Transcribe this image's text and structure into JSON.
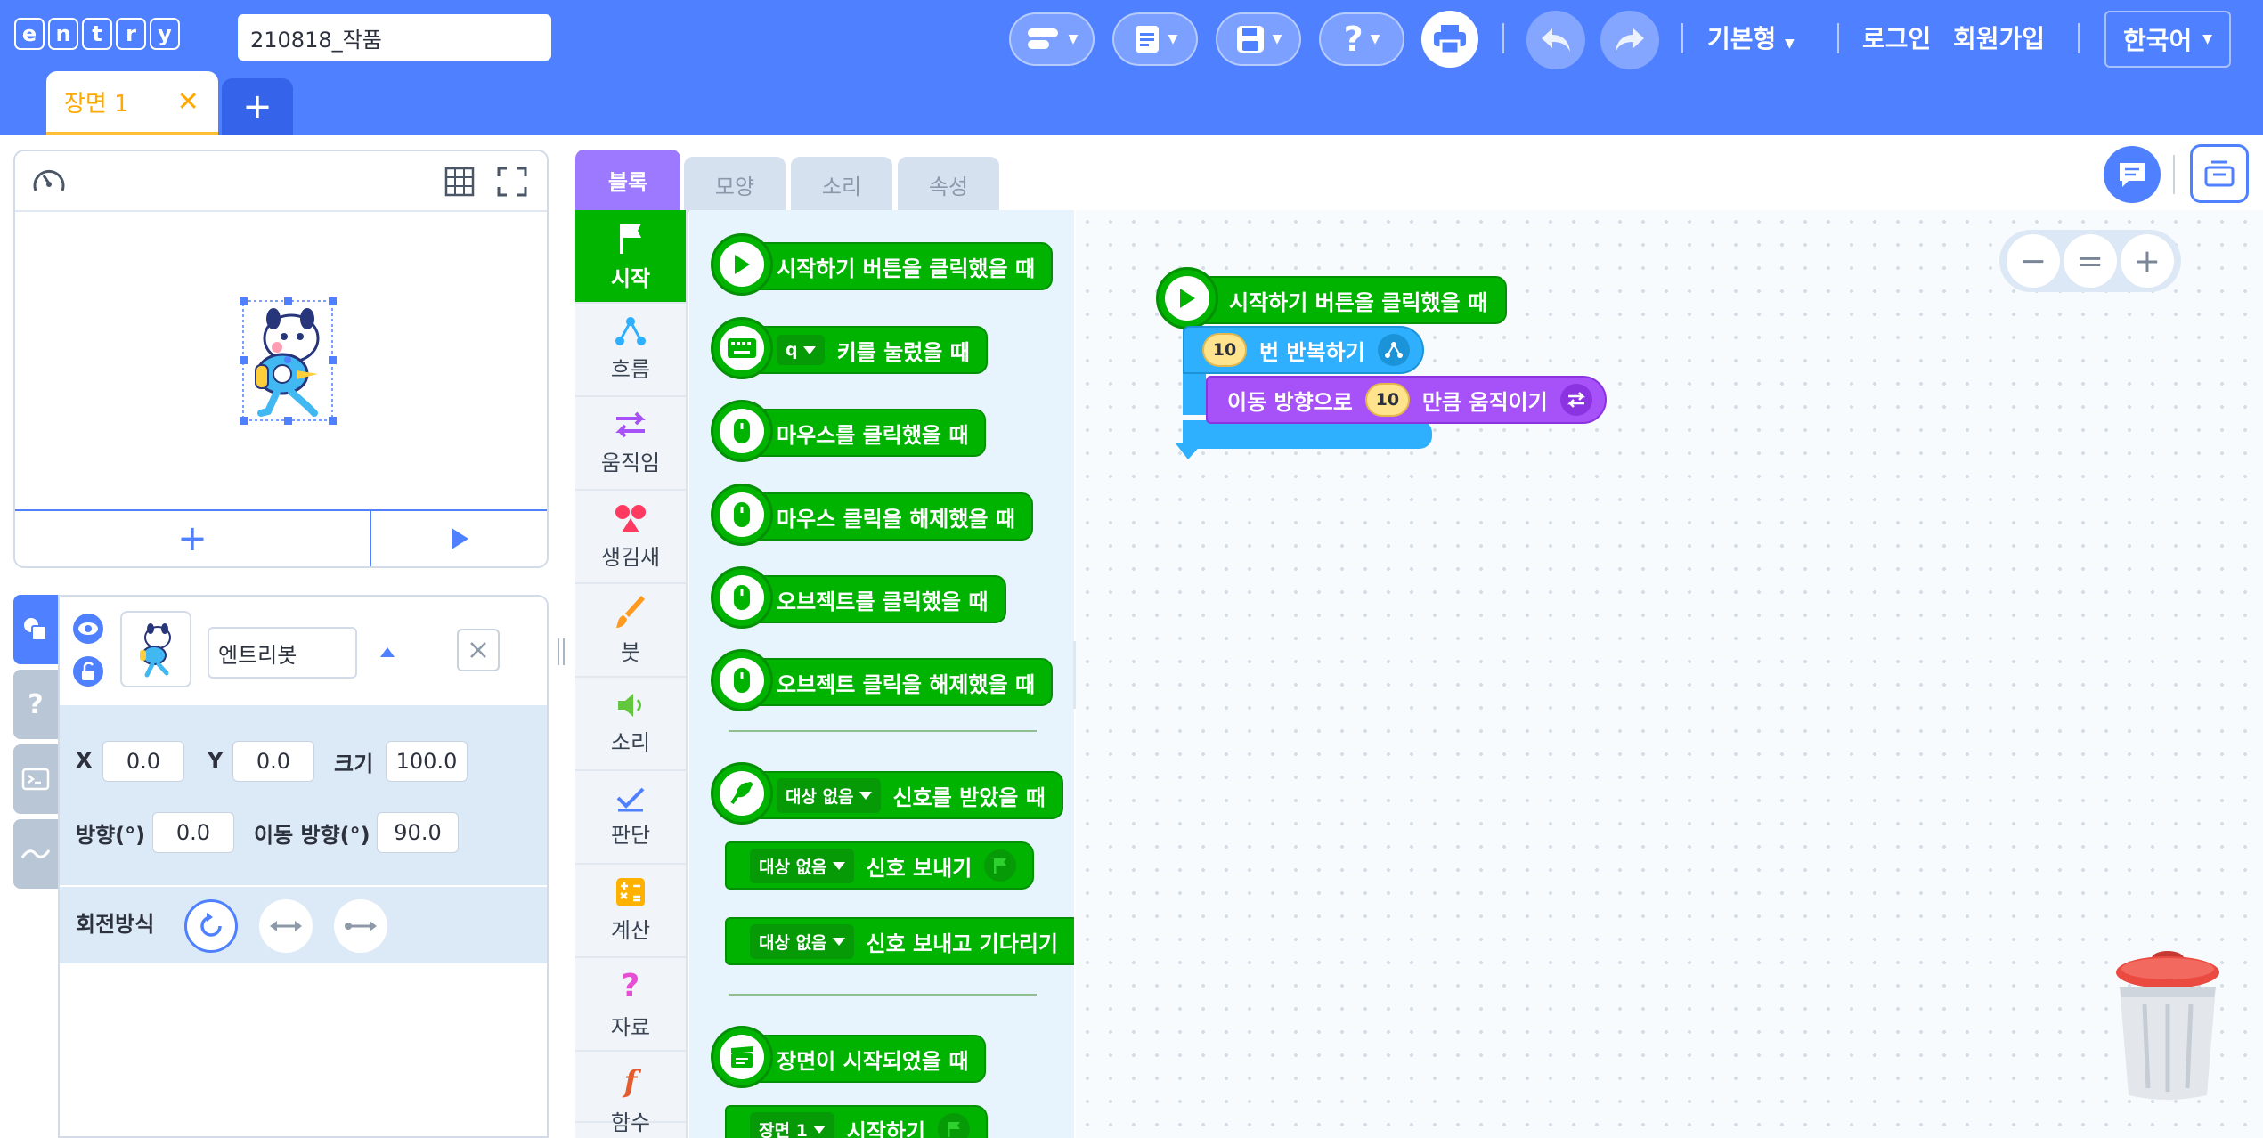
{
  "header": {
    "logo_letters": [
      "e",
      "n",
      "t",
      "r",
      "y"
    ],
    "project_title": "210818_작품",
    "mode_label": "기본형",
    "login_label": "로그인",
    "signup_label": "회원가입",
    "language_label": "한국어",
    "help_glyph": "?"
  },
  "scene": {
    "tab_label": "장면 1",
    "close_glyph": "✕",
    "add_glyph": "+"
  },
  "stage": {
    "add_glyph": "+"
  },
  "object": {
    "name": "엔트리봇",
    "x_label": "X",
    "x_value": "0.0",
    "y_label": "Y",
    "y_value": "0.0",
    "size_label": "크기",
    "size_value": "100.0",
    "direction_label": "방향(°)",
    "direction_value": "0.0",
    "move_direction_label": "이동 방향(°)",
    "move_direction_value": "90.0",
    "rotation_label": "회전방식"
  },
  "tabs": {
    "blocks": "블록",
    "shape": "모양",
    "sound": "소리",
    "attribute": "속성"
  },
  "categories": [
    "시작",
    "흐름",
    "움직임",
    "생김새",
    "붓",
    "소리",
    "판단",
    "계산",
    "자료",
    "함수"
  ],
  "palette": {
    "when_start_clicked": "시작하기 버튼을 클릭했을 때",
    "key_value": "q",
    "key_pressed": "키를 눌렀을 때",
    "mouse_clicked": "마우스를 클릭했을 때",
    "mouse_released": "마우스 클릭을 해제했을 때",
    "object_clicked": "오브젝트를 클릭했을 때",
    "object_released": "오브젝트 클릭을 해제했을 때",
    "signal_target": "대상 없음",
    "signal_received": "신호를 받았을 때",
    "signal_send": "신호 보내기",
    "signal_send_wait": "신호 보내고 기다리기",
    "scene_started": "장면이 시작되었을 때",
    "scene_value": "장면 1",
    "scene_start": "시작하기"
  },
  "workspace": {
    "start_block": "시작하기 버튼을 클릭했을 때",
    "repeat_count": "10",
    "repeat_label": "번 반복하기",
    "move_prefix": "이동 방향으로",
    "move_amount": "10",
    "move_suffix": "만큼 움직이기"
  },
  "zoom": {
    "minus": "−",
    "reset": "=",
    "plus": "+"
  },
  "colors": {
    "brand_blue": "#4f80ff",
    "start_green": "#00b300",
    "flow_blue": "#2eb0ff",
    "move_purple": "#a751f9",
    "blocks_tab": "#9d79ff",
    "scene_orange": "#ffa800"
  }
}
